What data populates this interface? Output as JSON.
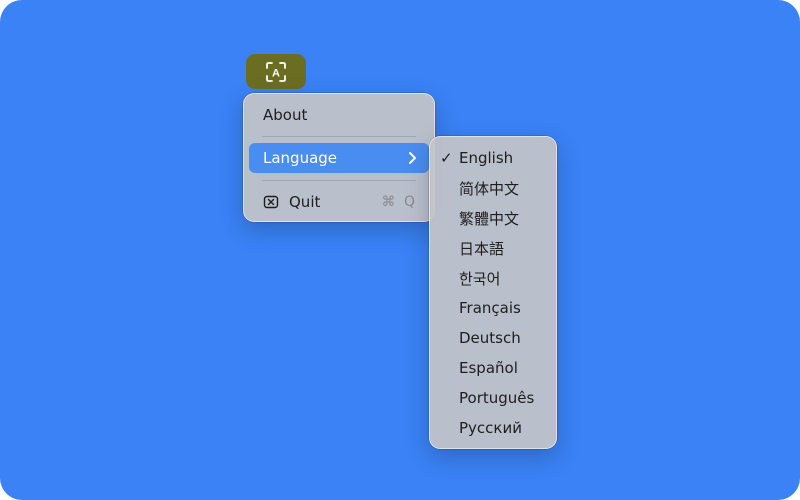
{
  "colors": {
    "desktop": "#3a82f6",
    "status_item": "#6b6e22",
    "menu_bg": "#c4c4c8",
    "highlight": "#4a8df0",
    "text": "#1e1e1e",
    "shortcut": "#8a8a8e"
  },
  "status_item": {
    "icon": "text-recognition-icon",
    "glyph": "A"
  },
  "menu": {
    "about_label": "About",
    "language_label": "Language",
    "language_chevron": "chevron-right-icon",
    "quit_label": "Quit",
    "quit_icon": "close-box-icon",
    "quit_shortcut": "⌘ Q"
  },
  "language_menu": {
    "selected_mark": "✓",
    "items": [
      {
        "label": "English",
        "selected": true
      },
      {
        "label": "简体中文",
        "selected": false
      },
      {
        "label": "繁體中文",
        "selected": false
      },
      {
        "label": "日本語",
        "selected": false
      },
      {
        "label": "한국어",
        "selected": false
      },
      {
        "label": "Français",
        "selected": false
      },
      {
        "label": "Deutsch",
        "selected": false
      },
      {
        "label": "Español",
        "selected": false
      },
      {
        "label": "Português",
        "selected": false
      },
      {
        "label": "Русский",
        "selected": false
      }
    ]
  }
}
